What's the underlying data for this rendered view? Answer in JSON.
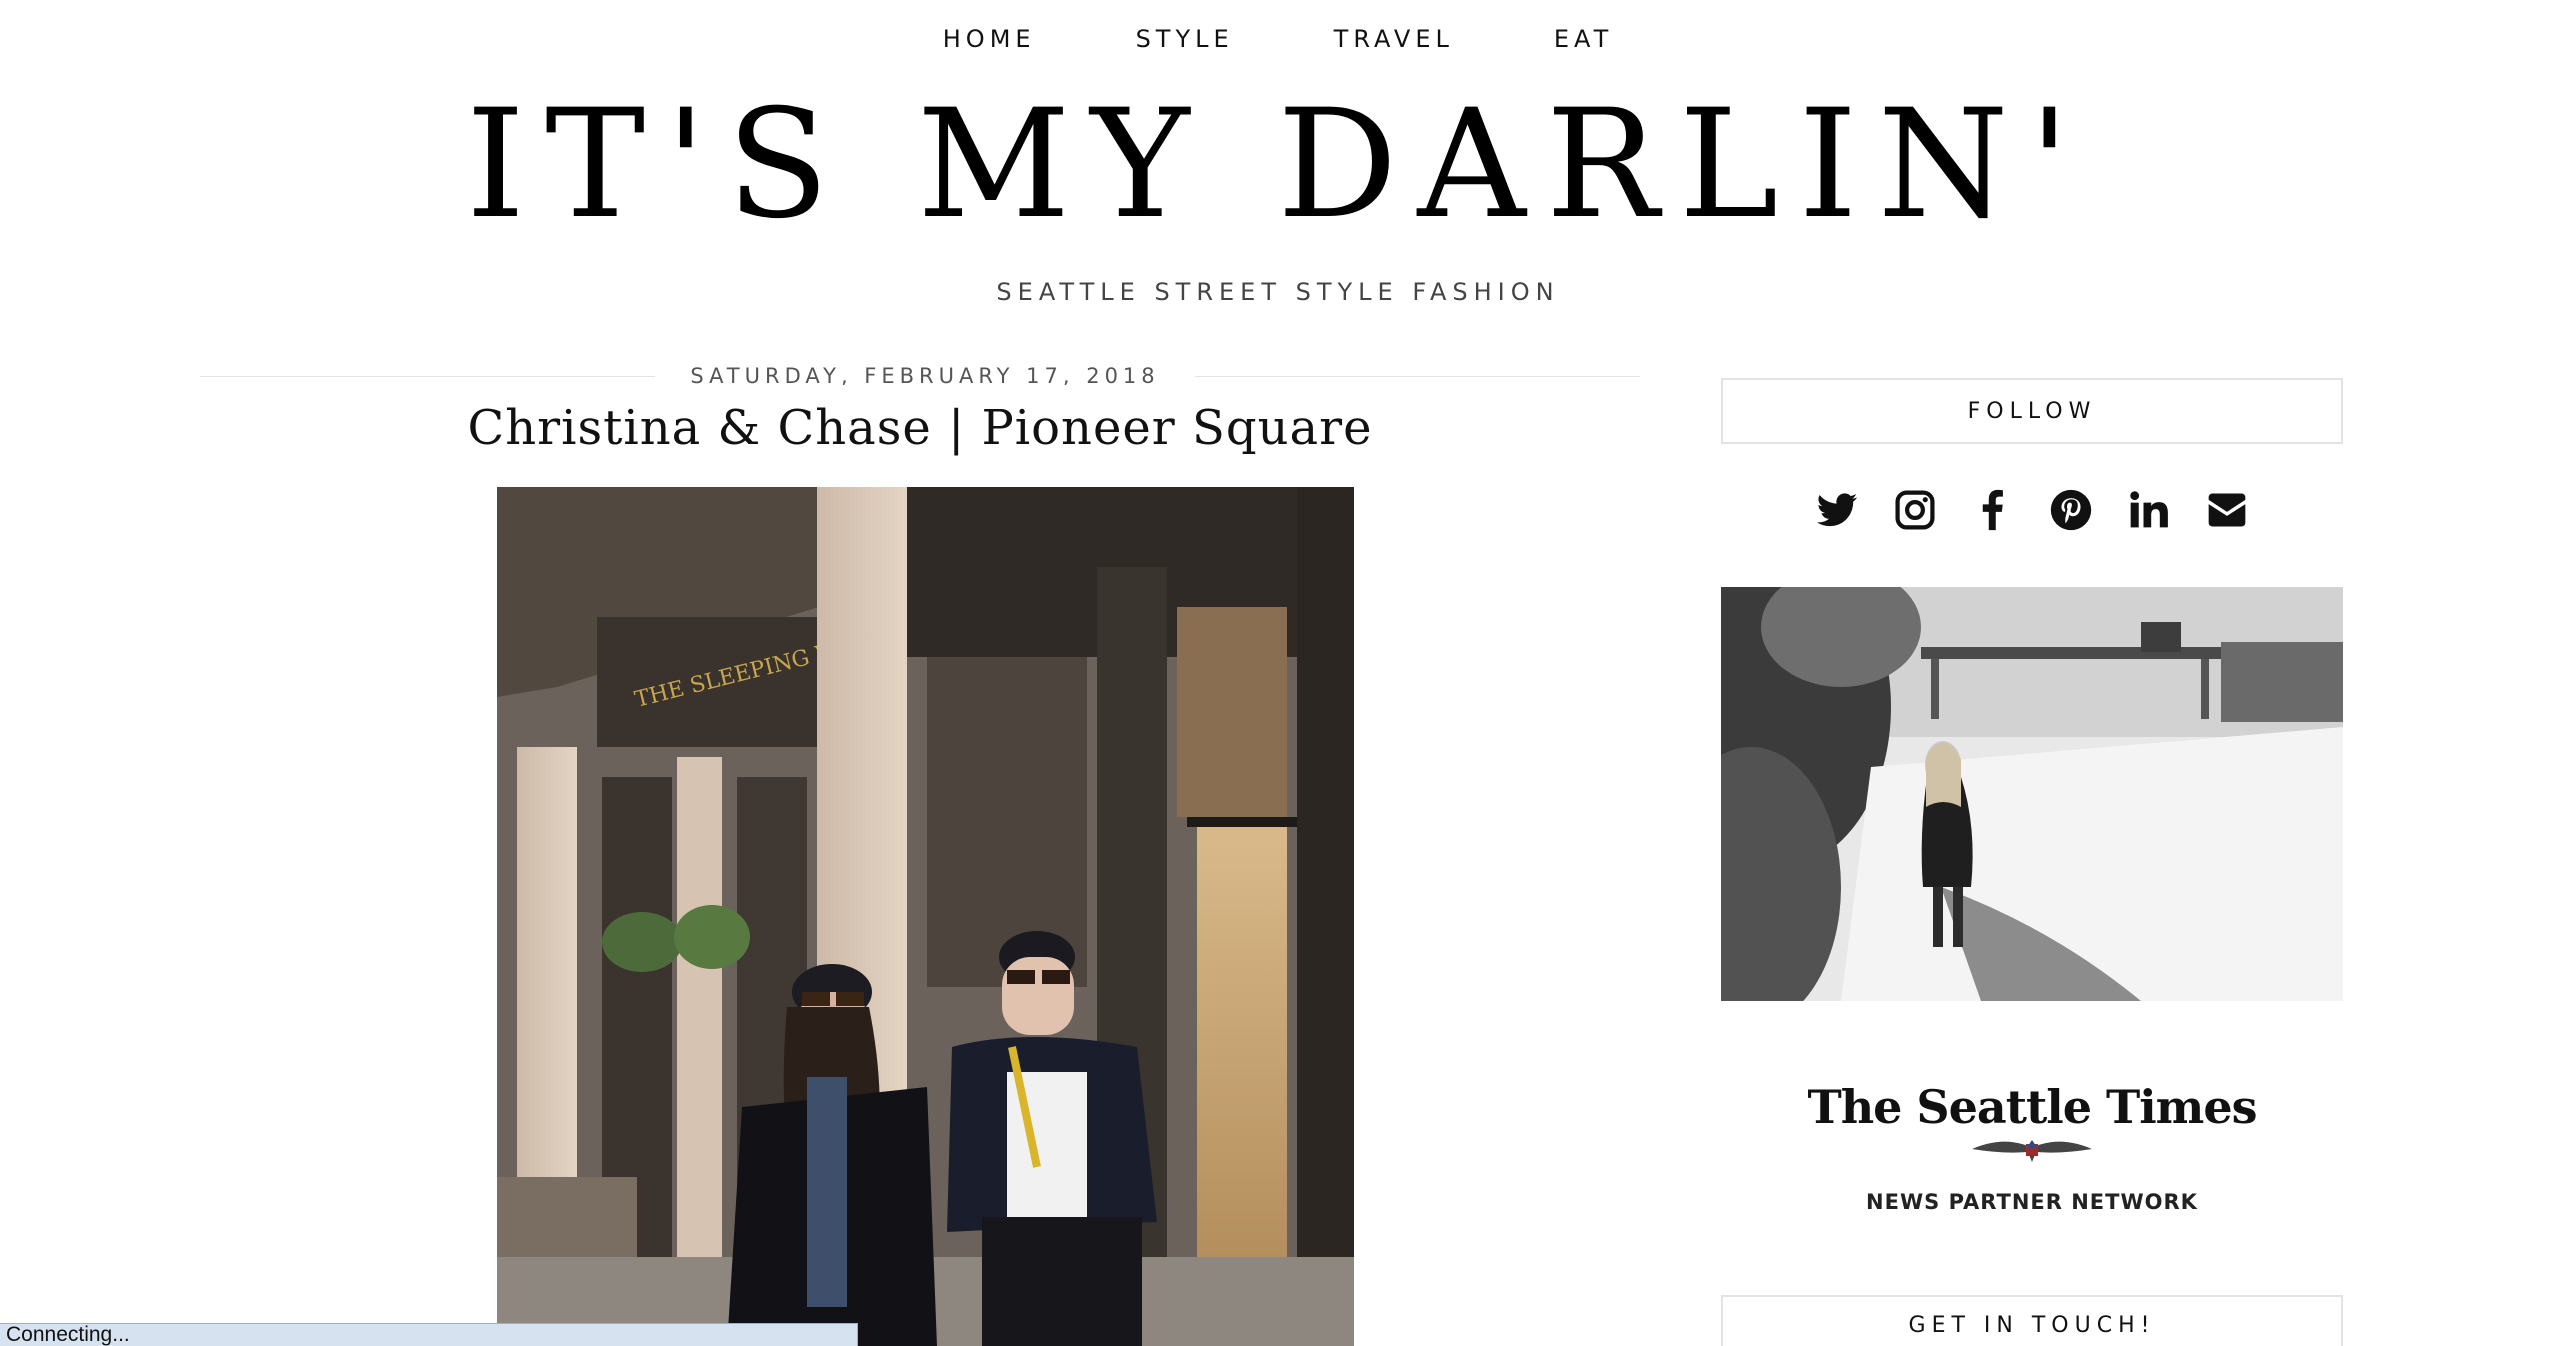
{
  "nav": {
    "items": [
      "HOME",
      "STYLE",
      "TRAVEL",
      "EAT"
    ]
  },
  "header": {
    "title": "IT'S MY DARLIN'",
    "tagline": "SEATTLE STREET STYLE FASHION"
  },
  "post": {
    "date": "SATURDAY, FEBRUARY 17, 2018",
    "title": "Christina & Chase | Pioneer Square"
  },
  "sidebar": {
    "follow_label": "FOLLOW",
    "social_icons": [
      "twitter-icon",
      "instagram-icon",
      "facebook-icon",
      "pinterest-icon",
      "linkedin-icon",
      "email-icon"
    ],
    "partner_wordmark": "The Seattle Times",
    "partner_network": "NEWS PARTNER NETWORK",
    "contact_label": "GET IN TOUCH!"
  },
  "status": {
    "text": "Connecting..."
  }
}
